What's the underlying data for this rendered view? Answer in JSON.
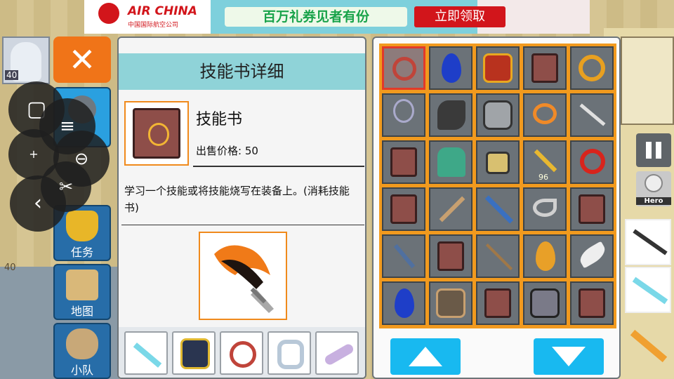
{
  "ad": {
    "brand": "AIR CHINA",
    "brand_sub": "中国国际航空公司",
    "slogan": "百万礼券见者有份",
    "cta": "立即领取"
  },
  "player": {
    "level": "40"
  },
  "side_menu": [
    {
      "label": "任务",
      "icon": "trophy-icon"
    },
    {
      "label": "地图",
      "icon": "map-icon"
    },
    {
      "label": "小队",
      "icon": "party-icon"
    }
  ],
  "hud": {
    "level_marker": "40",
    "pause_icon": "pause-icon",
    "hero_label": "Hero"
  },
  "detail": {
    "title": "技能书详细",
    "item_name": "技能书",
    "price_label": "出售价格: 50",
    "description": "学习一个技能或将技能烧写在装备上。(消耗技能书)",
    "skill_icon": "flaming-sword-skill-icon",
    "strip_items": [
      "ice-sword-icon",
      "horned-helmet-icon",
      "flower-ring-icon",
      "crystal-ring-icon",
      "feather-charm-icon"
    ]
  },
  "inventory": {
    "rows": [
      [
        "flower-ring-icon",
        "blue-gem-icon",
        "red-armor-icon",
        "skill-book-icon",
        "gold-ring-icon"
      ],
      [
        "pendant-icon",
        "dark-claw-icon",
        "iron-armor-icon",
        "orange-charm-icon",
        "katana-icon"
      ],
      [
        "skill-book-icon",
        "green-cape-icon",
        "ring-box-icon",
        "golden-key-icon",
        "red-boomerang-icon"
      ],
      [
        "skill-book-icon",
        "battle-axe-icon",
        "blue-greatsword-icon",
        "horn-icon",
        "skill-book-icon"
      ],
      [
        "dagger-icon",
        "skill-book-icon",
        "spear-icon",
        "amber-gem-icon",
        "feather-charm-icon"
      ],
      [
        "blue-gem-icon",
        "bronze-armor-icon",
        "skill-book-icon",
        "steel-armor-icon",
        "skill-book-icon"
      ]
    ],
    "key_count": "96",
    "selected": "flower-ring-icon",
    "up_icon": "arrow-up-icon",
    "down_icon": "arrow-down-icon"
  }
}
